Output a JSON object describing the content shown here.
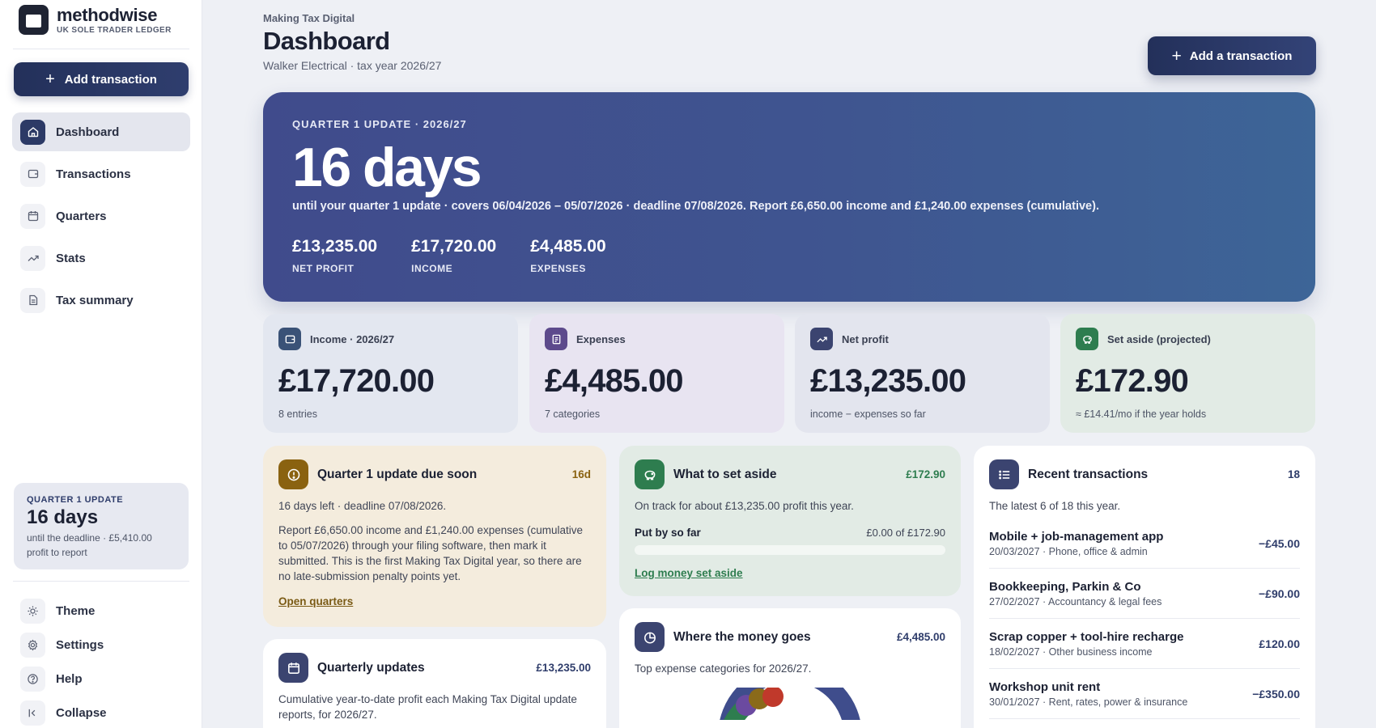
{
  "sidebar": {
    "brand_name": "methodwise",
    "brand_sub": "UK SOLE TRADER LEDGER",
    "add_button": "Add transaction",
    "nav": [
      {
        "label": "Dashboard",
        "icon": "home-icon"
      },
      {
        "label": "Transactions",
        "icon": "wallet-icon"
      },
      {
        "label": "Quarters",
        "icon": "calendar-icon"
      },
      {
        "label": "Stats",
        "icon": "trend-icon"
      },
      {
        "label": "Tax summary",
        "icon": "document-icon"
      }
    ],
    "quarter_card": {
      "kicker": "QUARTER 1 UPDATE",
      "days": "16 days",
      "sub": "until the deadline · £5,410.00 profit to report"
    },
    "bottom_nav": [
      {
        "label": "Theme",
        "icon": "sun-icon"
      },
      {
        "label": "Settings",
        "icon": "gear-icon"
      },
      {
        "label": "Help",
        "icon": "help-icon"
      },
      {
        "label": "Collapse",
        "icon": "collapse-icon"
      }
    ]
  },
  "header": {
    "breadcrumb": "Making Tax Digital",
    "title": "Dashboard",
    "subtitle": "Walker Electrical · tax year 2026/27",
    "add_button": "Add a transaction"
  },
  "hero": {
    "kicker": "QUARTER 1 UPDATE · 2026/27",
    "days": "16 days",
    "description": "until your quarter 1 update · covers 06/04/2026 – 05/07/2026 · deadline 07/08/2026. Report £6,650.00 income and £1,240.00 expenses (cumulative).",
    "stats": [
      {
        "value": "£13,235.00",
        "label": "NET PROFIT"
      },
      {
        "value": "£17,720.00",
        "label": "INCOME"
      },
      {
        "value": "£4,485.00",
        "label": "EXPENSES"
      }
    ]
  },
  "stat_cards": [
    {
      "title": "Income · 2026/27",
      "value": "£17,720.00",
      "sub": "8 entries",
      "bg": "#e3e7f0",
      "icon_bg": "#3a5277",
      "icon": "wallet-icon"
    },
    {
      "title": "Expenses",
      "value": "£4,485.00",
      "sub": "7 categories",
      "bg": "#e8e4f1",
      "icon_bg": "#5d4a8c",
      "icon": "receipt-icon"
    },
    {
      "title": "Net profit",
      "value": "£13,235.00",
      "sub": "income − expenses so far",
      "bg": "#e3e5ee",
      "icon_bg": "#3b4470",
      "icon": "trend-icon"
    },
    {
      "title": "Set aside (projected)",
      "value": "£172.90",
      "sub": "≈ £14.41/mo if the year holds",
      "bg": "#e2ebe5",
      "icon_bg": "#2e7d4f",
      "icon": "piggy-icon"
    }
  ],
  "due_panel": {
    "title": "Quarter 1 update due soon",
    "badge": "16d",
    "line1": "16 days left · deadline 07/08/2026.",
    "body": "Report £6,650.00 income and £1,240.00 expenses (cumulative to 05/07/2026) through your filing software, then mark it submitted. This is the first Making Tax Digital year, so there are no late-submission penalty points yet.",
    "link": "Open quarters"
  },
  "set_aside_panel": {
    "title": "What to set aside",
    "badge": "£172.90",
    "line1": "On track for about £13,235.00 profit this year.",
    "progress_label": "Put by so far",
    "progress_value": "£0.00 of £172.90",
    "progress_fraction": 0,
    "link": "Log money set aside"
  },
  "money_panel": {
    "title": "Where the money goes",
    "badge": "£4,485.00",
    "line1": "Top expense categories for 2026/27."
  },
  "quarterly_panel": {
    "title": "Quarterly updates",
    "badge": "£13,235.00",
    "line1": "Cumulative year-to-date profit each Making Tax Digital update reports, for 2026/27."
  },
  "recent_panel": {
    "title": "Recent transactions",
    "badge": "18",
    "line1": "The latest 6 of 18 this year.",
    "rows": [
      {
        "name": "Mobile + job-management app",
        "meta": "20/03/2027 · Phone, office & admin",
        "amount": "−£45.00"
      },
      {
        "name": "Bookkeeping, Parkin & Co",
        "meta": "27/02/2027 · Accountancy & legal fees",
        "amount": "−£90.00"
      },
      {
        "name": "Scrap copper + tool-hire recharge",
        "meta": "18/02/2027 · Other business income",
        "amount": "£120.00"
      },
      {
        "name": "Workshop unit rent",
        "meta": "30/01/2027 · Rent, rates, power & insurance",
        "amount": "−£350.00"
      }
    ]
  }
}
